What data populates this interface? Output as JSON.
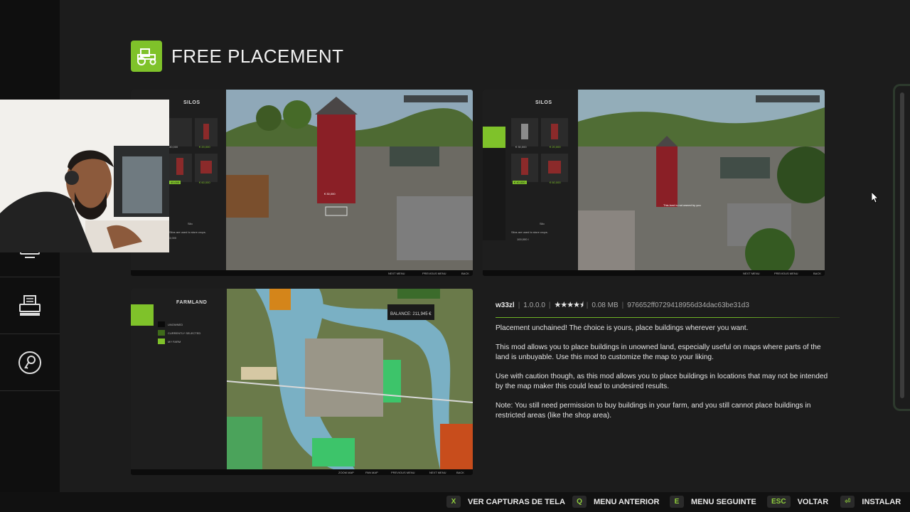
{
  "header": {
    "title": "FREE PLACEMENT",
    "icon": "tractor-icon"
  },
  "sidebar": {
    "items": [
      {
        "icon": "monitor-icon"
      },
      {
        "icon": "printer-icon"
      },
      {
        "icon": "key-badge-icon"
      }
    ]
  },
  "screenshots": [
    {
      "panel_title": "SILOS",
      "prices": [
        "30,000",
        "€ 20,000",
        "40,000",
        "€ 60,000"
      ],
      "caption": "Silo",
      "subcaption": "Silos are used to store crops.",
      "value": "3,000",
      "footer": [
        "NEXT MENU",
        "PREVIOUS MENU",
        "BACK"
      ],
      "scene_text": "€ 30,000"
    },
    {
      "panel_title": "SILOS",
      "prices": [
        "€ 30,000",
        "€ 20,000",
        "€ 40,000",
        "€ 60,000"
      ],
      "caption": "Silo",
      "subcaption": "Silos are used to store crops.",
      "value": "100,000 l",
      "footer": [
        "NEXT MENU",
        "PREVIOUS MENU",
        "BACK"
      ],
      "scene_text": "This land is not owned by you"
    },
    {
      "panel_title": "FARMLAND",
      "legend": [
        "UNOWNED",
        "CURRENTLY SELECTED",
        "MY FARM"
      ],
      "balance": "BALANCE: 211,945 €",
      "footer": [
        "ZOOM MAP",
        "PAN MAP",
        "PREVIOUS MENU",
        "NEXT MENU",
        "BACK"
      ]
    }
  ],
  "mod": {
    "author": "w33zl",
    "version": "1.0.0.0",
    "rating_stars": 4.5,
    "size": "0.08 MB",
    "hash": "976652ff0729418956d34dac63be31d3",
    "description": [
      "Placement unchained! The choice is yours, place buildings wherever you want.",
      "This mod allows you to place buildings in unowned land, especially useful on maps where parts of the land is unbuyable. Use this mod to customize the map to your liking.",
      "Use with caution though, as this mod allows you to place buildings in locations that may not be intended by the map maker this could lead to undesired results.",
      "Note: You still need permission to buy buildings in your farm, and you still cannot place buildings in restricted areas (like the shop area)."
    ]
  },
  "hints": [
    {
      "key": "X",
      "label": "VER CAPTURAS DE TELA"
    },
    {
      "key": "Q",
      "label": "MENU ANTERIOR"
    },
    {
      "key": "E",
      "label": "MENU SEGUINTE"
    },
    {
      "key": "ESC",
      "label": "VOLTAR"
    },
    {
      "key": "⏎",
      "label": "INSTALAR"
    }
  ],
  "colors": {
    "accent": "#7fc22a",
    "background": "#1c1c1c",
    "sidebar": "#0f0f0f"
  }
}
